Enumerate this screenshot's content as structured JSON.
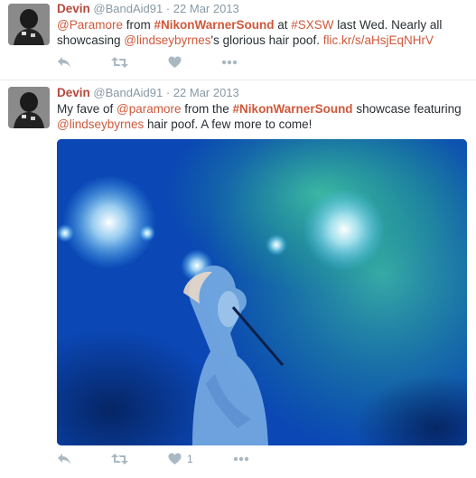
{
  "tweets": [
    {
      "fullname": "Devin",
      "username": "@BandAid91",
      "separator": "·",
      "date": "22 Mar 2013",
      "text": {
        "mention1": "@Paramore",
        "t1": " from ",
        "hashtag1": "#NikonWarnerSound",
        "t2": " at ",
        "hashtag2": "#SXSW",
        "t3": " last Wed. Nearly all showcasing ",
        "mention2": "@lindseybyrnes",
        "t4": "'s glorious hair poof.  ",
        "link": "flic.kr/s/aHsjEqNHrV"
      },
      "actions": {
        "reply": "reply-icon",
        "retweet": "retweet-icon",
        "like": "heart-icon",
        "more": "more-icon"
      }
    },
    {
      "fullname": "Devin",
      "username": "@BandAid91",
      "separator": "·",
      "date": "22 Mar 2013",
      "text": {
        "t1": "My fave of ",
        "mention1": "@paramore",
        "t2": " from the ",
        "hashtag1": "#NikonWarnerSound",
        "t3": " showcase featuring ",
        "mention2": "@lindseybyrnes",
        "t4": " hair poof. A few more to come!"
      },
      "likes_count": "1",
      "actions": {
        "reply": "reply-icon",
        "retweet": "retweet-icon",
        "like": "heart-icon",
        "more": "more-icon"
      }
    }
  ],
  "colors": {
    "fullname": "#b5483c",
    "link": "#d0583a",
    "icon": "#aab8c2",
    "meta": "#8899a6"
  }
}
